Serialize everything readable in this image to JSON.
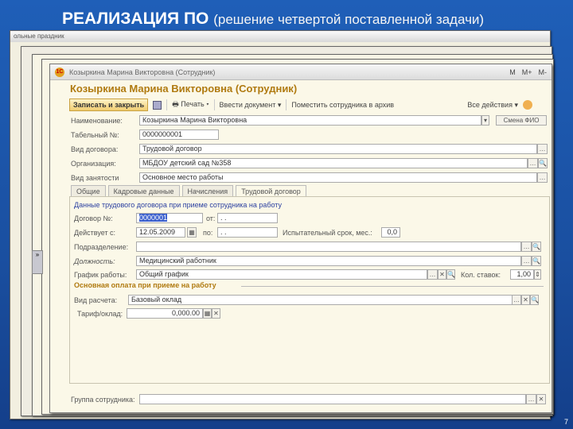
{
  "slide": {
    "title": "РЕАЛИЗАЦИЯ ПО",
    "subtitle": "(решение четвертой поставленной задачи)",
    "page_number": "7"
  },
  "background": {
    "window_title": "ольные праздник"
  },
  "window": {
    "titlebar": "Козыркина Марина Викторовна (Сотрудник)",
    "titlebar_buttons": [
      "M",
      "M+",
      "M-"
    ],
    "heading": "Козыркина Марина Викторовна (Сотрудник)",
    "toolbar": {
      "save_close": "Записать и закрыть",
      "print": "Печать",
      "enter_doc": "Ввести документ",
      "archive": "Поместить сотрудника в архив",
      "all_actions": "Все действия"
    },
    "fields": {
      "name_label": "Наименование:",
      "name_value": "Козыркина Марина Викторовна",
      "change_fio": "Смена ФИО",
      "tab_no_label": "Табельный №:",
      "tab_no_value": "0000000001",
      "contract_type_label": "Вид договора:",
      "contract_type_value": "Трудовой договор",
      "org_label": "Организация:",
      "org_value": "МБДОУ детский сад №358",
      "employment_label": "Вид занятости",
      "employment_value": "Основное место работы"
    },
    "tabs": [
      "Общие",
      "Кадровые данные",
      "Начисления",
      "Трудовой договор"
    ],
    "contract": {
      "section": "Данные трудового договора при приеме сотрудника на работу",
      "contract_no_label": "Договор №:",
      "contract_no_value": "0000001",
      "from_label": "от:",
      "from_value": ". .",
      "valid_from_label": "Действует с:",
      "valid_from_value": "12.05.2009",
      "to_label": "по:",
      "to_value": ". .",
      "probation_label": "Испытательный срок, мес.:",
      "probation_value": "0,0",
      "dept_label": "Подразделение:",
      "dept_value": "",
      "position_label": "Должность:",
      "position_value": "Медицинский работник",
      "schedule_label": "График работы:",
      "schedule_value": "Общий график",
      "rate_label": "Кол. ставок:",
      "rate_value": "1,00",
      "pay_group": "Основная оплата при приеме на работу",
      "calc_label": "Вид расчета:",
      "calc_value": "Базовый оклад",
      "tariff_label": "Тариф/оклад:",
      "tariff_value": "0,000.00",
      "group_label": "Группа сотрудника:",
      "group_value": ""
    }
  }
}
